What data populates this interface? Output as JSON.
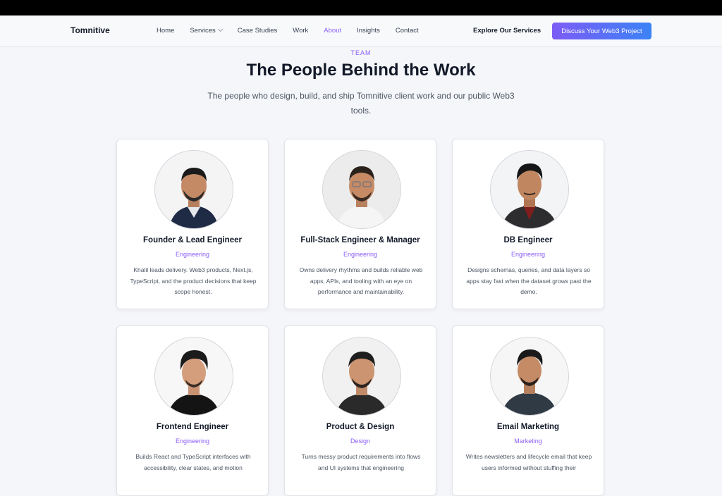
{
  "nav": {
    "brand": "Tomnitive",
    "items": [
      {
        "label": "Home",
        "active": false
      },
      {
        "label": "Services",
        "active": false,
        "has_dropdown": true
      },
      {
        "label": "Case Studies",
        "active": false
      },
      {
        "label": "Work",
        "active": false
      },
      {
        "label": "About",
        "active": true
      },
      {
        "label": "Insights",
        "active": false
      },
      {
        "label": "Contact",
        "active": false
      }
    ],
    "explore": "Explore Our Services",
    "cta": "Discuss Your Web3 Project"
  },
  "hero": {
    "eyebrow": "TEAM",
    "title": "The People Behind the Work",
    "subtitle": "The people who design, build, and ship Tomnitive client work and our public Web3 tools."
  },
  "team": [
    {
      "role": "Founder & Lead Engineer",
      "dept": "Engineering",
      "desc": "Khalil leads delivery. Web3 products, Next.js, TypeScript, and the product decisions that keep scope honest."
    },
    {
      "role": "Full-Stack Engineer & Manager",
      "dept": "Engineering",
      "desc": "Owns delivery rhythms and builds reliable web apps, APIs, and tooling with an eye on performance and maintainability."
    },
    {
      "role": "DB Engineer",
      "dept": "Engineering",
      "desc": "Designs schemas, queries, and data layers so apps stay fast when the dataset grows past the demo."
    },
    {
      "role": "Frontend Engineer",
      "dept": "Engineering",
      "desc": "Builds React and TypeScript interfaces with accessibility, clear states, and motion"
    },
    {
      "role": "Product & Design",
      "dept": "Design",
      "desc": "Turns messy product requirements into flows and UI systems that engineering"
    },
    {
      "role": "Email Marketing",
      "dept": "Marketing",
      "desc": "Writes newsletters and lifecycle email that keep users informed without stuffing their"
    }
  ],
  "colors": {
    "accent": "#8b5cf6",
    "cta_start": "#7c5cf5",
    "cta_end": "#3b82f6"
  }
}
